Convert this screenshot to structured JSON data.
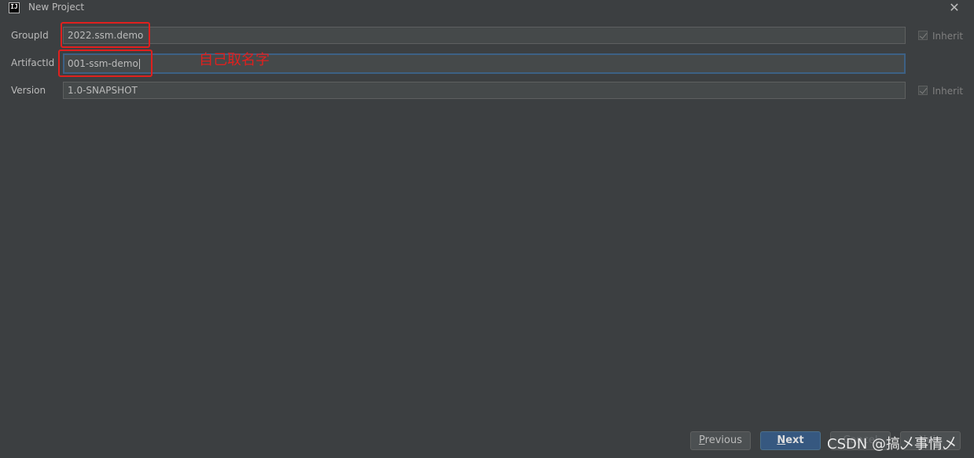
{
  "window": {
    "title": "New Project",
    "app_icon_text": "IJ"
  },
  "form": {
    "group_id": {
      "label": "GroupId",
      "value": "2022.ssm.demo",
      "inherit_label": "Inherit",
      "inherit_checked": true
    },
    "artifact_id": {
      "label": "ArtifactId",
      "value": "001-ssm-demo"
    },
    "version": {
      "label": "Version",
      "value": "1.0-SNAPSHOT",
      "inherit_label": "Inherit",
      "inherit_checked": true
    }
  },
  "annotation": {
    "text": "自己取名字",
    "color": "#e0201e"
  },
  "buttons": {
    "previous": {
      "mnemonic": "P",
      "rest": "revious"
    },
    "next": {
      "mnemonic": "N",
      "rest": "ext"
    },
    "cancel": {
      "label": "Cancel"
    },
    "help": {
      "label": "Help"
    }
  },
  "watermark": {
    "text": "CSDN @搞乄事情乄"
  },
  "colors": {
    "background": "#3c3f41",
    "field": "#45494a",
    "focus_border": "#3d6185",
    "primary_button": "#365880"
  }
}
